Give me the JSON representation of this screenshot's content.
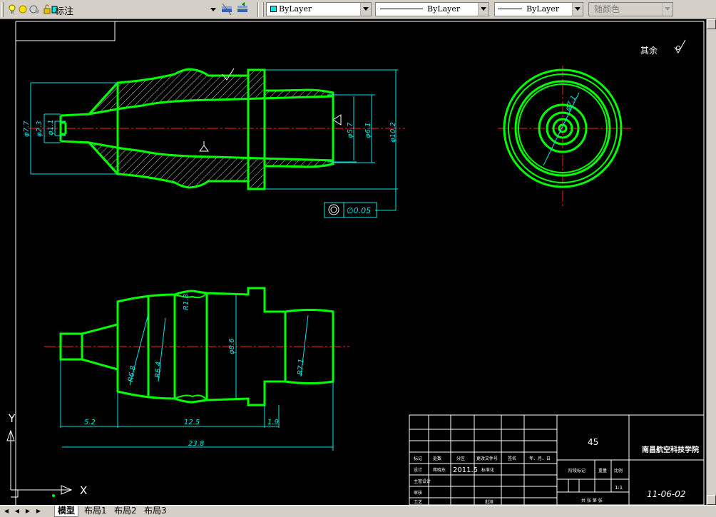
{
  "toolbar": {
    "layer_name": "标注",
    "color_control": "ByLayer",
    "linetype_control": "ByLayer",
    "lineweight_control": "ByLayer",
    "plotstyle_control": "随颜色"
  },
  "drawing": {
    "roughness_note": "其余",
    "dimensions": {
      "d77": "φ7.7",
      "d23": "φ2.3",
      "d11": "φ1.1",
      "d57": "φ5.7",
      "d61": "φ6.1",
      "d102": "φ10.2",
      "tolerance": "∅0.05",
      "d71_end": "φ7.1",
      "r18": "R1.8",
      "d86": "φ8.6",
      "r68": "R6.8",
      "r64": "R6.4",
      "r71": "R7.1",
      "l52": "5.2",
      "l125": "12.5",
      "l19": "1.9",
      "l238": "23.8",
      "ra_small": "1.6"
    },
    "title_block": {
      "material": "45",
      "institution": "南昌航空科技学院",
      "drawing_no": "11-06-02",
      "date": "2011.5",
      "scale": "1:1",
      "row1": [
        "标记",
        "处数",
        "分区",
        "更改文件号",
        "签名",
        "年、月、日"
      ],
      "design": "设计",
      "designer": "蒋晓东",
      "standardize": "标准化",
      "stage_mark": "阶段标记",
      "weight": "重量",
      "ratio": "比例",
      "check": "审核",
      "craft": "工艺",
      "approve": "批准",
      "main_designer": "主管设计",
      "sheet_info": "共 张 第 张"
    }
  },
  "ucs": {
    "x_label": "X",
    "y_label": "Y"
  },
  "tabs": {
    "model": "模型",
    "layout1": "布局1",
    "layout2": "布局2",
    "layout3": "布局3"
  }
}
